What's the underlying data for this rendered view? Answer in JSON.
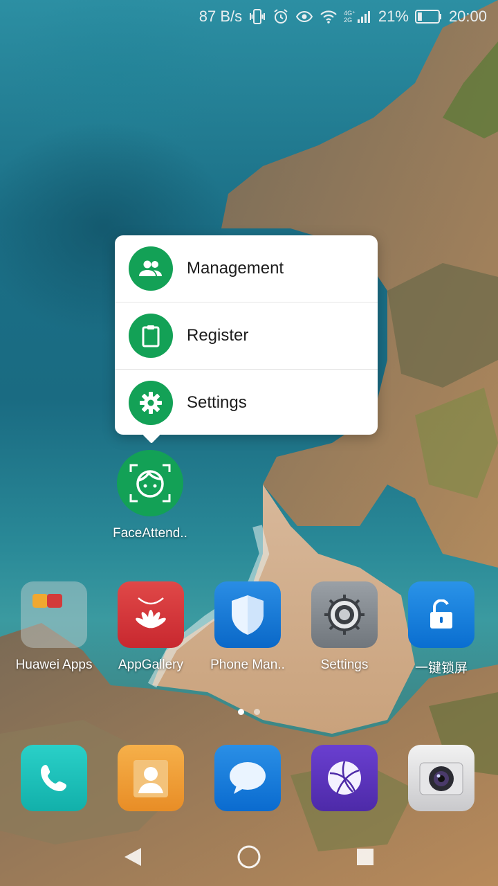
{
  "status_bar": {
    "network_speed": "87 B/s",
    "network_type_top": "4G⁺",
    "network_type_bottom": "2G",
    "battery_percent": "21%",
    "battery_level": 0.21,
    "time": "20:00",
    "icons": [
      "vibrate-icon",
      "alarm-icon",
      "eye-icon",
      "wifi-icon",
      "signal-icon",
      "battery-icon"
    ]
  },
  "popup_menu": {
    "items": [
      {
        "label": "Management",
        "icon": "people-icon"
      },
      {
        "label": "Register",
        "icon": "clipboard-icon"
      },
      {
        "label": "Settings",
        "icon": "gear-icon"
      }
    ],
    "accent": "#13a156"
  },
  "face_app": {
    "label": "FaceAttend..",
    "icon": "face-scan-icon"
  },
  "home_row": [
    {
      "label": "Huawei Apps",
      "icon": "folder-icon"
    },
    {
      "label": "AppGallery",
      "icon": "appgallery-icon"
    },
    {
      "label": "Phone Man..",
      "icon": "shield-icon"
    },
    {
      "label": "Settings",
      "icon": "gear-icon"
    },
    {
      "label": "一键锁屏",
      "icon": "unlock-icon"
    }
  ],
  "page_indicator": {
    "count": 2,
    "active": 1
  },
  "dock": [
    {
      "label": "Phone",
      "icon": "phone-icon"
    },
    {
      "label": "Contacts",
      "icon": "contacts-icon"
    },
    {
      "label": "Messages",
      "icon": "message-icon"
    },
    {
      "label": "Browser",
      "icon": "browser-icon"
    },
    {
      "label": "Camera",
      "icon": "camera-icon"
    }
  ],
  "nav": [
    "back-icon",
    "home-icon",
    "recents-icon"
  ]
}
